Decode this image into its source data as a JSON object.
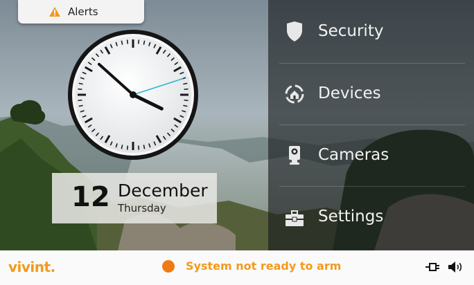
{
  "alerts": {
    "label": "Alerts",
    "icon": "warning-icon"
  },
  "clock": {
    "hour": 3,
    "minute": 52,
    "second": 12
  },
  "date": {
    "day": "12",
    "month": "December",
    "weekday": "Thursday"
  },
  "menu": {
    "items": [
      {
        "label": "Security",
        "icon": "shield-icon"
      },
      {
        "label": "Devices",
        "icon": "devices-icon"
      },
      {
        "label": "Cameras",
        "icon": "camera-icon"
      },
      {
        "label": "Settings",
        "icon": "toolbox-icon"
      }
    ]
  },
  "status_bar": {
    "logo": "vivint.",
    "status_text": "System not ready to arm",
    "status_color": "#f07a12",
    "icons": [
      "power-plug-icon",
      "volume-icon"
    ]
  },
  "colors": {
    "accent": "#f29a1e",
    "second_hand": "#1fb7c7"
  }
}
